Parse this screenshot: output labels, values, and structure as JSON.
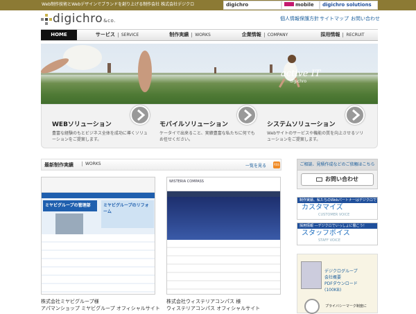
{
  "header": {
    "tagline": "Web制作技術とWebデザインでブランドを創り上げる制作会社 株式会社デジクロ",
    "sites": [
      "digichro",
      "mobile",
      "digichro solutions"
    ],
    "logo_text": "digichro",
    "logo_suffix": "&co.",
    "links": [
      "個人情報保護方針",
      "サイトマップ",
      "お問い合わせ"
    ]
  },
  "nav": [
    {
      "jp": "HOME",
      "en": ""
    },
    {
      "jp": "サービス",
      "en": "SERVICE"
    },
    {
      "jp": "制作実績",
      "en": "WORKS"
    },
    {
      "jp": "企業情報",
      "en": "COMPANY"
    },
    {
      "jp": "採用情報",
      "en": "RECRUIT"
    }
  ],
  "hero": {
    "tagline": "active IT",
    "sub": "digichro"
  },
  "solutions": [
    {
      "title": "WEBソリューション",
      "desc": "豊富な経験のもとビジネス全体を成功に導くソリューションをご提案します。"
    },
    {
      "title": "モバイルソリューション",
      "desc": "ケータイで出来ること、実績豊富な私たちに何でもお任せください。"
    },
    {
      "title": "システムソリューション",
      "desc": "Webサイトのサービスや機能の質を向上させるソリューションをご提案します。"
    }
  ],
  "works": {
    "title": "最新制作実績",
    "en": "WORKS",
    "more": "一覧を見る",
    "rss": "RSS",
    "items": [
      {
        "company": "株式会社ミヤビグループ様",
        "site": "アパマンショップ ミヤビグループ オフィシャルサイト",
        "thumb_main": "ミヤビグループの管理部",
        "thumb_sub": "ミヤビグループのリフォーム"
      },
      {
        "company": "株式会社ウィステリアコンパス 様",
        "site": "ウィステリアコンパス オフィシャルサイト",
        "thumb_main": "WISTERIA COMPASS",
        "thumb_sub": ""
      }
    ]
  },
  "sidebar": {
    "head": "ご相談、見積作成などのご依頼はこちら",
    "contact": "お問い合わせ",
    "banners": [
      {
        "top": "制作実績、私たちのWebパートナーはデジクロです！",
        "main": "カスタマイズ",
        "sub": "CUSTOMER VOICE"
      },
      {
        "top": "採用情報 ―デジクロでいっしょに働こう！",
        "main": "スタッフボイス",
        "sub": "STAFF VOICE"
      }
    ],
    "pdf": [
      "デジクログループ",
      "会社概要",
      "PDFダウンロード",
      "(100KB)"
    ],
    "privacy": "プライバシーマーク制度に"
  },
  "colors": {
    "topbar": "#8c7a34",
    "link": "#1c5f9c",
    "nav_active": "#111111"
  }
}
